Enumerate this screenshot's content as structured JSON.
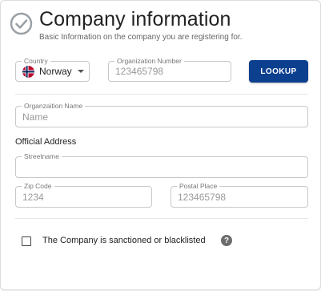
{
  "header": {
    "title": "Company information",
    "subtitle": "Basic Information on the company you are registering for."
  },
  "fields": {
    "country": {
      "label": "Country",
      "value": "Norway"
    },
    "org_number": {
      "label": "Organization Number",
      "placeholder": "123465798"
    },
    "org_name": {
      "label": "Organzaition Name",
      "placeholder": "Name"
    },
    "street": {
      "label": "Streetname",
      "value": ""
    },
    "zip": {
      "label": "Zip Code",
      "placeholder": "1234"
    },
    "postal_place": {
      "label": "Postal Place",
      "placeholder": "123465798"
    }
  },
  "buttons": {
    "lookup": "LOOKUP"
  },
  "sections": {
    "address_title": "Official Address"
  },
  "sanction": {
    "label": "The Company is sanctioned or blacklisted",
    "checked": false
  },
  "icons": {
    "header": "check-circle-icon",
    "help": "help-icon",
    "flag": "norway-flag-icon"
  },
  "colors": {
    "primary": "#0d3f8f"
  }
}
